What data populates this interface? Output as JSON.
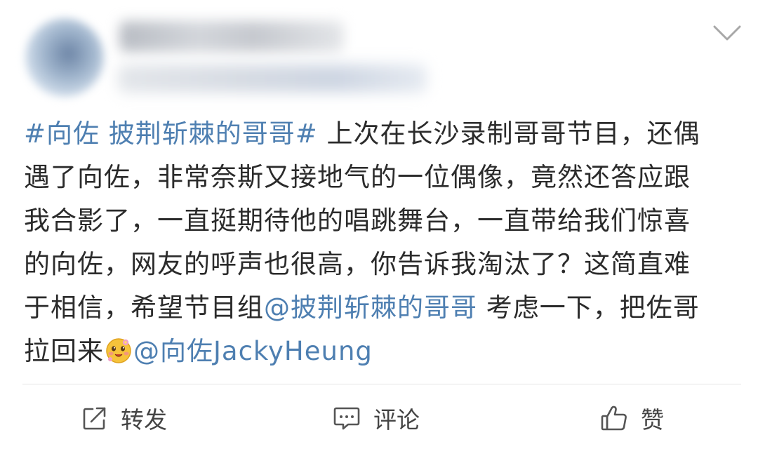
{
  "post": {
    "lines": [
      {
        "link": "#向佐 披荆斩棘的哥哥#",
        "text": " 上次在长沙录制哥哥节目，还偶"
      },
      {
        "text": "遇了向佐，非常奈斯又接地气的一位偶像，竟然还答应跟"
      },
      {
        "text": "我合影了，一直挺期待他的唱跳舞台，一直带给我们惊喜"
      },
      {
        "text": "的向佐，网友的呼声也很高，你告诉我淘汰了？这简直难"
      },
      {
        "pre": "于相信，希望节目组",
        "link": "@披荆斩棘的哥哥",
        "post": " 考虑一下，把佐哥"
      },
      {
        "pre": "拉回来",
        "emoji": "cute-face-emoji",
        "link": "@向佐JackyHeung"
      }
    ]
  },
  "header": {
    "more_icon": "chevron-down-icon"
  },
  "actions": {
    "repost": {
      "label": "转发",
      "icon": "share-icon"
    },
    "comment": {
      "label": "评论",
      "icon": "comment-icon"
    },
    "like": {
      "label": "赞",
      "icon": "thumbs-up-icon"
    }
  },
  "colors": {
    "link": "#4e7fb1",
    "text": "#2b2b2b",
    "action_text": "#444444",
    "divider": "#e6e6e6"
  }
}
